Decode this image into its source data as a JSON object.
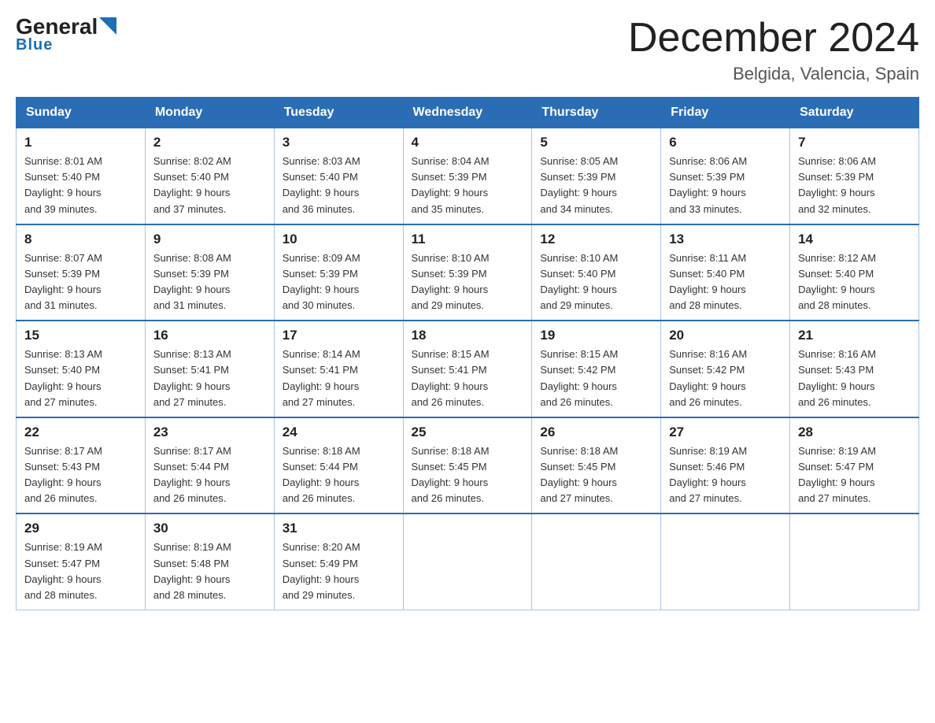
{
  "logo": {
    "general": "General",
    "arrow": "▲",
    "blue": "Blue"
  },
  "title": "December 2024",
  "subtitle": "Belgida, Valencia, Spain",
  "days_header": [
    "Sunday",
    "Monday",
    "Tuesday",
    "Wednesday",
    "Thursday",
    "Friday",
    "Saturday"
  ],
  "weeks": [
    [
      {
        "num": "1",
        "sunrise": "8:01 AM",
        "sunset": "5:40 PM",
        "daylight": "9 hours and 39 minutes."
      },
      {
        "num": "2",
        "sunrise": "8:02 AM",
        "sunset": "5:40 PM",
        "daylight": "9 hours and 37 minutes."
      },
      {
        "num": "3",
        "sunrise": "8:03 AM",
        "sunset": "5:40 PM",
        "daylight": "9 hours and 36 minutes."
      },
      {
        "num": "4",
        "sunrise": "8:04 AM",
        "sunset": "5:39 PM",
        "daylight": "9 hours and 35 minutes."
      },
      {
        "num": "5",
        "sunrise": "8:05 AM",
        "sunset": "5:39 PM",
        "daylight": "9 hours and 34 minutes."
      },
      {
        "num": "6",
        "sunrise": "8:06 AM",
        "sunset": "5:39 PM",
        "daylight": "9 hours and 33 minutes."
      },
      {
        "num": "7",
        "sunrise": "8:06 AM",
        "sunset": "5:39 PM",
        "daylight": "9 hours and 32 minutes."
      }
    ],
    [
      {
        "num": "8",
        "sunrise": "8:07 AM",
        "sunset": "5:39 PM",
        "daylight": "9 hours and 31 minutes."
      },
      {
        "num": "9",
        "sunrise": "8:08 AM",
        "sunset": "5:39 PM",
        "daylight": "9 hours and 31 minutes."
      },
      {
        "num": "10",
        "sunrise": "8:09 AM",
        "sunset": "5:39 PM",
        "daylight": "9 hours and 30 minutes."
      },
      {
        "num": "11",
        "sunrise": "8:10 AM",
        "sunset": "5:39 PM",
        "daylight": "9 hours and 29 minutes."
      },
      {
        "num": "12",
        "sunrise": "8:10 AM",
        "sunset": "5:40 PM",
        "daylight": "9 hours and 29 minutes."
      },
      {
        "num": "13",
        "sunrise": "8:11 AM",
        "sunset": "5:40 PM",
        "daylight": "9 hours and 28 minutes."
      },
      {
        "num": "14",
        "sunrise": "8:12 AM",
        "sunset": "5:40 PM",
        "daylight": "9 hours and 28 minutes."
      }
    ],
    [
      {
        "num": "15",
        "sunrise": "8:13 AM",
        "sunset": "5:40 PM",
        "daylight": "9 hours and 27 minutes."
      },
      {
        "num": "16",
        "sunrise": "8:13 AM",
        "sunset": "5:41 PM",
        "daylight": "9 hours and 27 minutes."
      },
      {
        "num": "17",
        "sunrise": "8:14 AM",
        "sunset": "5:41 PM",
        "daylight": "9 hours and 27 minutes."
      },
      {
        "num": "18",
        "sunrise": "8:15 AM",
        "sunset": "5:41 PM",
        "daylight": "9 hours and 26 minutes."
      },
      {
        "num": "19",
        "sunrise": "8:15 AM",
        "sunset": "5:42 PM",
        "daylight": "9 hours and 26 minutes."
      },
      {
        "num": "20",
        "sunrise": "8:16 AM",
        "sunset": "5:42 PM",
        "daylight": "9 hours and 26 minutes."
      },
      {
        "num": "21",
        "sunrise": "8:16 AM",
        "sunset": "5:43 PM",
        "daylight": "9 hours and 26 minutes."
      }
    ],
    [
      {
        "num": "22",
        "sunrise": "8:17 AM",
        "sunset": "5:43 PM",
        "daylight": "9 hours and 26 minutes."
      },
      {
        "num": "23",
        "sunrise": "8:17 AM",
        "sunset": "5:44 PM",
        "daylight": "9 hours and 26 minutes."
      },
      {
        "num": "24",
        "sunrise": "8:18 AM",
        "sunset": "5:44 PM",
        "daylight": "9 hours and 26 minutes."
      },
      {
        "num": "25",
        "sunrise": "8:18 AM",
        "sunset": "5:45 PM",
        "daylight": "9 hours and 26 minutes."
      },
      {
        "num": "26",
        "sunrise": "8:18 AM",
        "sunset": "5:45 PM",
        "daylight": "9 hours and 27 minutes."
      },
      {
        "num": "27",
        "sunrise": "8:19 AM",
        "sunset": "5:46 PM",
        "daylight": "9 hours and 27 minutes."
      },
      {
        "num": "28",
        "sunrise": "8:19 AM",
        "sunset": "5:47 PM",
        "daylight": "9 hours and 27 minutes."
      }
    ],
    [
      {
        "num": "29",
        "sunrise": "8:19 AM",
        "sunset": "5:47 PM",
        "daylight": "9 hours and 28 minutes."
      },
      {
        "num": "30",
        "sunrise": "8:19 AM",
        "sunset": "5:48 PM",
        "daylight": "9 hours and 28 minutes."
      },
      {
        "num": "31",
        "sunrise": "8:20 AM",
        "sunset": "5:49 PM",
        "daylight": "9 hours and 29 minutes."
      },
      null,
      null,
      null,
      null
    ]
  ],
  "labels": {
    "sunrise": "Sunrise:",
    "sunset": "Sunset:",
    "daylight": "Daylight:"
  }
}
